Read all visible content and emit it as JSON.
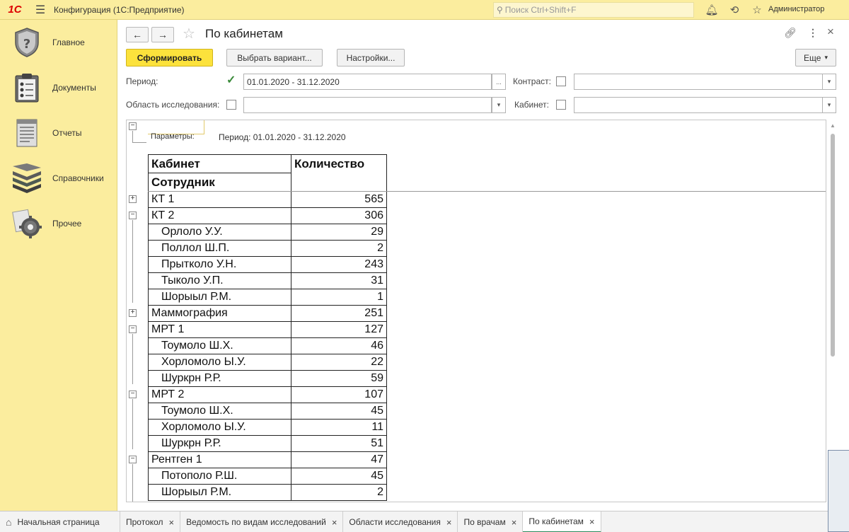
{
  "topbar": {
    "logo": "1С",
    "title": "Конфигурация  (1С:Предприятие)",
    "search_placeholder": "Поиск Ctrl+Shift+F",
    "username": "Администратор"
  },
  "sidebar": {
    "items": [
      {
        "label": "Главное",
        "icon": "shield-icon"
      },
      {
        "label": "Документы",
        "icon": "clipboard-icon"
      },
      {
        "label": "Отчеты",
        "icon": "report-icon"
      },
      {
        "label": "Справочники",
        "icon": "books-icon"
      },
      {
        "label": "Прочее",
        "icon": "gears-icon"
      }
    ]
  },
  "header": {
    "title": "По кабинетам"
  },
  "toolbar": {
    "generate": "Сформировать",
    "choose_variant": "Выбрать вариант...",
    "settings": "Настройки...",
    "more": "Еще"
  },
  "filters": {
    "period_label": "Период:",
    "period_value": "01.01.2020 - 31.12.2020",
    "period_checked": true,
    "contrast_label": "Контраст:",
    "area_label": "Область исследования:",
    "cabinet_label": "Кабинет:",
    "ellipsis": "...",
    "dropdown_arrow": "▾"
  },
  "report": {
    "params_label": "Параметры:",
    "params_value": "Период: 01.01.2020 - 31.12.2020",
    "col_cabinet": "Кабинет",
    "col_employee": "Сотрудник",
    "col_count": "Количество",
    "rows": [
      {
        "name": "КТ 1",
        "count": "565",
        "level": 0,
        "toggle": "+"
      },
      {
        "name": "КТ 2",
        "count": "306",
        "level": 0,
        "toggle": "−"
      },
      {
        "name": "Орлоло У.У.",
        "count": "29",
        "level": 1
      },
      {
        "name": "Поллол Ш.П.",
        "count": "2",
        "level": 1
      },
      {
        "name": "Прытколо У.Н.",
        "count": "243",
        "level": 1
      },
      {
        "name": "Тыколо У.П.",
        "count": "31",
        "level": 1
      },
      {
        "name": "Шорыыл Р.М.",
        "count": "1",
        "level": 1
      },
      {
        "name": "Маммография",
        "count": "251",
        "level": 0,
        "toggle": "+"
      },
      {
        "name": "МРТ 1",
        "count": "127",
        "level": 0,
        "toggle": "−"
      },
      {
        "name": "Тоумоло Ш.Х.",
        "count": "46",
        "level": 1
      },
      {
        "name": "Хорломоло Ы.У.",
        "count": "22",
        "level": 1
      },
      {
        "name": "Шуркрн Р.Р.",
        "count": "59",
        "level": 1
      },
      {
        "name": "МРТ 2",
        "count": "107",
        "level": 0,
        "toggle": "−"
      },
      {
        "name": "Тоумоло Ш.Х.",
        "count": "45",
        "level": 1
      },
      {
        "name": "Хорломоло Ы.У.",
        "count": "11",
        "level": 1
      },
      {
        "name": "Шуркрн Р.Р.",
        "count": "51",
        "level": 1
      },
      {
        "name": "Рентген 1",
        "count": "47",
        "level": 0,
        "toggle": "−"
      },
      {
        "name": "Потополо Р.Ш.",
        "count": "45",
        "level": 1
      },
      {
        "name": "Шорыыл Р.М.",
        "count": "2",
        "level": 1
      }
    ]
  },
  "tabs": [
    {
      "label": "Начальная страница",
      "closable": false
    },
    {
      "label": "Протокол",
      "closable": true
    },
    {
      "label": "Ведомость по видам исследований",
      "closable": true
    },
    {
      "label": "Области исследования",
      "closable": true
    },
    {
      "label": "По врачам",
      "closable": true
    },
    {
      "label": "По кабинетам",
      "closable": true,
      "active": true
    }
  ],
  "colors": {
    "sidebar_bg": "#fbed9e",
    "primary_button": "#fce23c",
    "active_tab_accent": "#2a8a5c"
  }
}
